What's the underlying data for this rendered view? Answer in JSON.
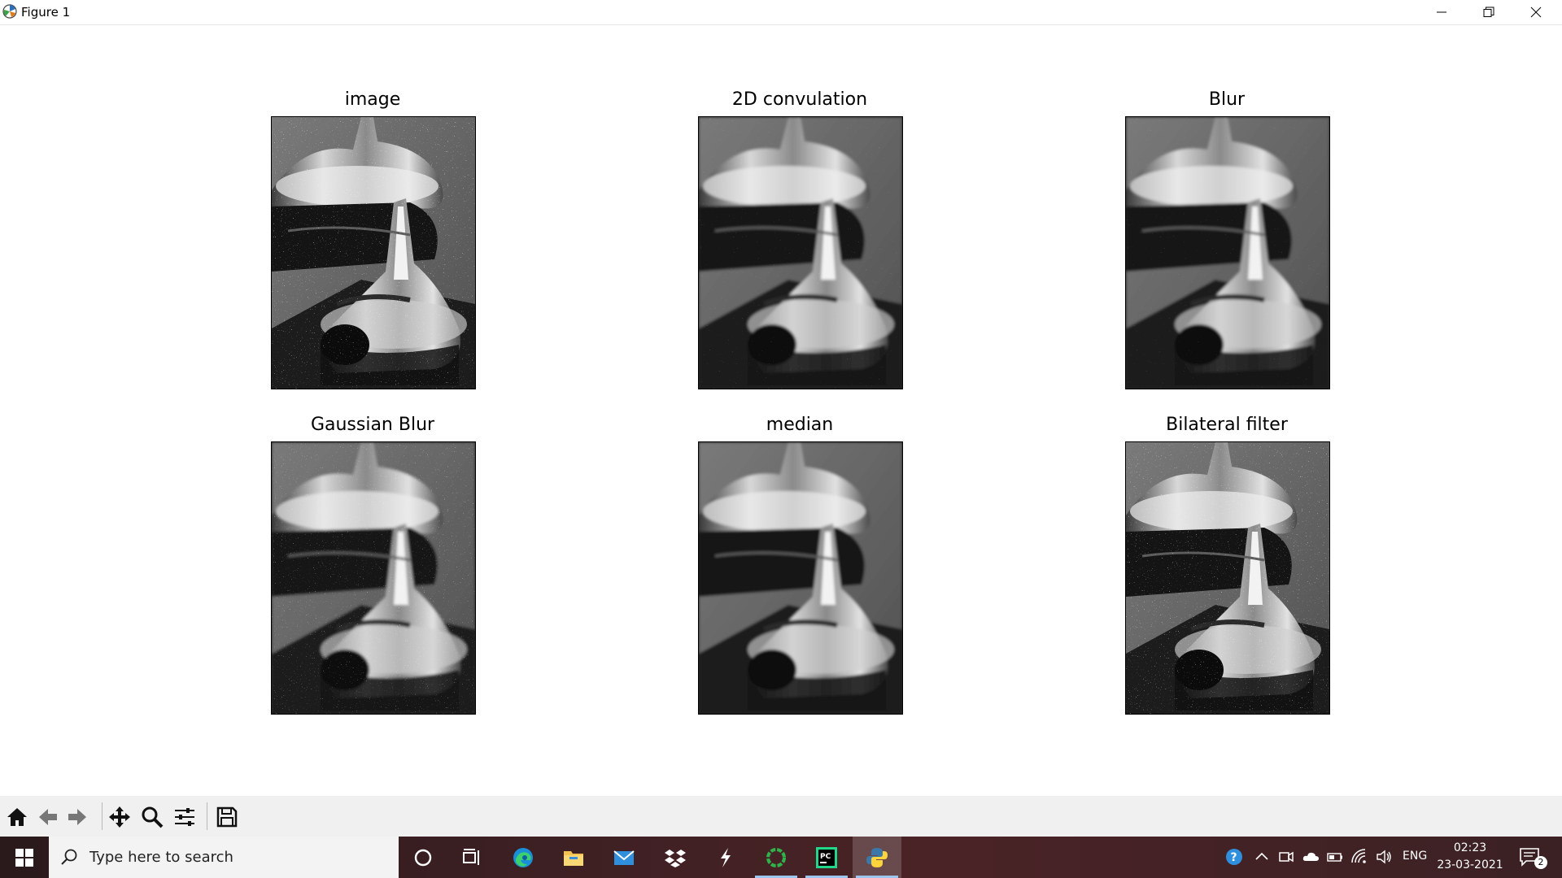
{
  "window": {
    "title": "Figure 1",
    "controls": [
      "minimize",
      "restore",
      "close"
    ]
  },
  "subplots": [
    {
      "title": "image"
    },
    {
      "title": "2D convulation"
    },
    {
      "title": "Blur"
    },
    {
      "title": "Gaussian Blur"
    },
    {
      "title": "median"
    },
    {
      "title": "Bilateral filter"
    }
  ],
  "toolbar": {
    "buttons": [
      "home-icon",
      "back-arrow-icon",
      "forward-arrow-icon",
      "pan-icon",
      "zoom-icon",
      "configure-subplots-icon",
      "save-icon"
    ]
  },
  "taskbar": {
    "search_placeholder": "Type here to search",
    "apps": [
      "cortana-icon",
      "task-view-icon",
      "edge-icon",
      "file-explorer-icon",
      "mail-icon",
      "dropbox-icon",
      "lightning-app-icon",
      "green-ring-app-icon",
      "pycharm-icon",
      "python-icon"
    ],
    "tray": {
      "language": "ENG",
      "time": "02:23",
      "date": "23-03-2021",
      "notification_count": "2"
    }
  },
  "colors": {
    "taskbar_bg": "#3a1f22",
    "toolbar_bg": "#f0f0f0",
    "active_underline": "#9ec4f0"
  }
}
